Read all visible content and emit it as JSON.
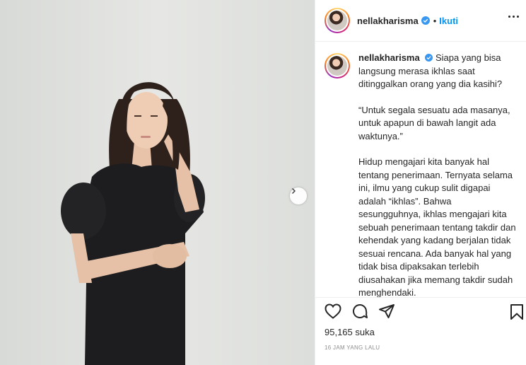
{
  "post": {
    "username": "nellakharisma",
    "follow_separator": "•",
    "follow_label": "Ikuti",
    "caption_lines": [
      "Siapa yang bisa langsung merasa ikhlas saat ditinggalkan orang yang dia kasihi?",
      "“Untuk segala sesuatu ada masanya, untuk apapun di bawah langit ada waktunya.”",
      "Hidup mengajari kita banyak hal tentang penerimaan. Ternyata selama ini, ilmu yang cukup sulit digapai adalah “ikhlas”. Bahwa sesungguhnya, ikhlas mengajari kita sebuah penerimaan tentang takdir dan kehendak yang kadang berjalan tidak sesuai rencana. Ada banyak hal yang tidak bisa dipaksakan terlebih diusahakan jika memang takdir sudah menghendaki."
    ],
    "likes": "95,165 suka",
    "timestamp": "16 JAM YANG LALU"
  },
  "icons": {
    "verified": "verified-badge-icon",
    "like": "heart-icon",
    "comment": "comment-icon",
    "share": "share-icon",
    "save": "bookmark-icon",
    "more": "more-options-icon",
    "next": "chevron-right-icon"
  },
  "colors": {
    "accent": "#0095f6",
    "text": "#262626",
    "muted": "#8e8e8e",
    "photo_bg": "#e1e3e0"
  }
}
